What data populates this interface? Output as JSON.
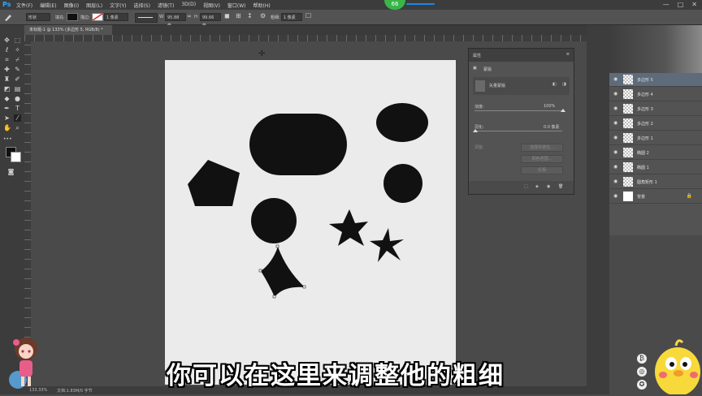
{
  "app": {
    "logo": "Ps",
    "badge": "66"
  },
  "menu": [
    "文件(F)",
    "编辑(E)",
    "图像(I)",
    "图层(L)",
    "文字(Y)",
    "选择(S)",
    "滤镜(T)",
    "3D(D)",
    "视图(V)",
    "窗口(W)",
    "帮助(H)"
  ],
  "window_controls": {
    "minimize": "—",
    "maximize": "□",
    "close": "✕"
  },
  "options": {
    "mode": "形状",
    "fill_label": "填充:",
    "stroke_label": "描边:",
    "stroke_width": "1 像素",
    "w_label": "W:",
    "w_value": "95.88 像",
    "h_label": "H:",
    "h_value": "99.66 像",
    "thickness_label": "粗细:",
    "thickness_value": "1 像素"
  },
  "document_tab": "未标题-1 @ 133% (多边形 5, RGB/8) *",
  "properties": {
    "title": "属性",
    "section": "蒙版",
    "mask_label": "矢量蒙版",
    "density_label": "浓度:",
    "density_value": "100%",
    "feather_label": "羽化:",
    "feather_value": "0.0 像素",
    "refine_label": "调整:",
    "btn_select_mask": "选择并遮住...",
    "btn_color_range": "颜色范围...",
    "btn_invert": "反相"
  },
  "layers": [
    {
      "name": "多边形 5",
      "thumb": "checker"
    },
    {
      "name": "多边形 4",
      "thumb": "checker"
    },
    {
      "name": "多边形 3",
      "thumb": "checker"
    },
    {
      "name": "多边形 2",
      "thumb": "checker"
    },
    {
      "name": "多边形 1",
      "thumb": "checker"
    },
    {
      "name": "椭圆 2",
      "thumb": "checker"
    },
    {
      "name": "椭圆 1",
      "thumb": "checker"
    },
    {
      "name": "圆角矩形 1",
      "thumb": "checker"
    },
    {
      "name": "背景",
      "thumb": "white"
    }
  ],
  "status": {
    "zoom": "133.33%",
    "doc": "文档:1.83M/0 字节"
  },
  "subtitle": "你可以在这里来调整他的粗细",
  "colors": {
    "shape_fill": "#111111",
    "canvas": "#ebebeb",
    "workspace": "#4a4a4a",
    "accent_badge": "#39b54a",
    "ps_blue": "#31a8ff"
  }
}
